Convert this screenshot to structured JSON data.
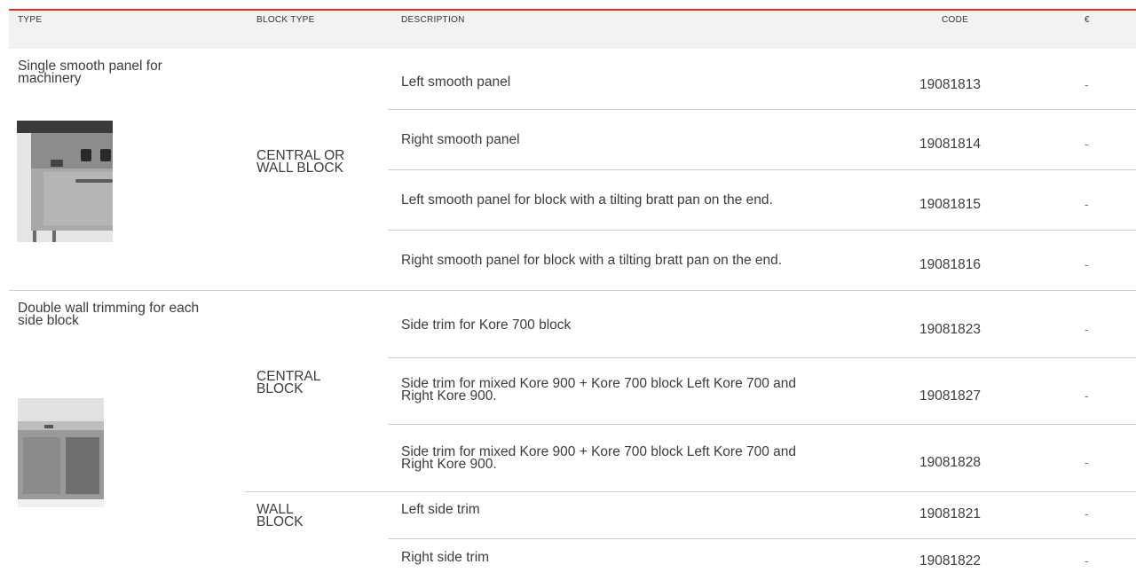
{
  "header": {
    "type": "TYPE",
    "block_type": "BLOCK TYPE",
    "description": "DESCRIPTION",
    "code": "CODE",
    "price": "€"
  },
  "groups": [
    {
      "type_line1": "Single smooth panel for",
      "type_line2": "machinery",
      "image_icon": "smooth-panel-machinery-photo",
      "blocks": [
        {
          "block_line1": "CENTRAL OR",
          "block_line2": "WALL BLOCK",
          "rows": [
            {
              "desc1": "Left smooth panel",
              "desc2": "",
              "code": "19081813",
              "price": "-"
            },
            {
              "desc1": "Right smooth panel",
              "desc2": "",
              "code": "19081814",
              "price": "-"
            },
            {
              "desc1": "Left smooth panel for block with a tilting bratt pan on the end.",
              "desc2": "",
              "code": "19081815",
              "price": "-"
            },
            {
              "desc1": "Right smooth panel for block with a tilting bratt pan on the end.",
              "desc2": "",
              "code": "19081816",
              "price": "-"
            }
          ]
        }
      ]
    },
    {
      "type_line1": "Double wall trimming for each",
      "type_line2": "side block",
      "image_icon": "side-trim-block-photo",
      "blocks": [
        {
          "block_line1": "CENTRAL",
          "block_line2": "BLOCK",
          "rows": [
            {
              "desc1": "Side trim for Kore 700 block",
              "desc2": "",
              "code": "19081823",
              "price": "-"
            },
            {
              "desc1": "Side trim for mixed Kore 900 + Kore 700 block Left Kore 700 and",
              "desc2": "Right Kore 900.",
              "code": "19081827",
              "price": "-"
            },
            {
              "desc1": "Side trim for mixed Kore 900 + Kore 700 block Left Kore 700 and",
              "desc2": "Right Kore 900.",
              "code": "19081828",
              "price": "-"
            }
          ]
        },
        {
          "block_line1": "WALL",
          "block_line2": "BLOCK",
          "rows": [
            {
              "desc1": "Left side trim",
              "desc2": "",
              "code": "19081821",
              "price": "-"
            },
            {
              "desc1": "Right side trim",
              "desc2": "",
              "code": "19081822",
              "price": "-"
            }
          ]
        }
      ]
    }
  ]
}
